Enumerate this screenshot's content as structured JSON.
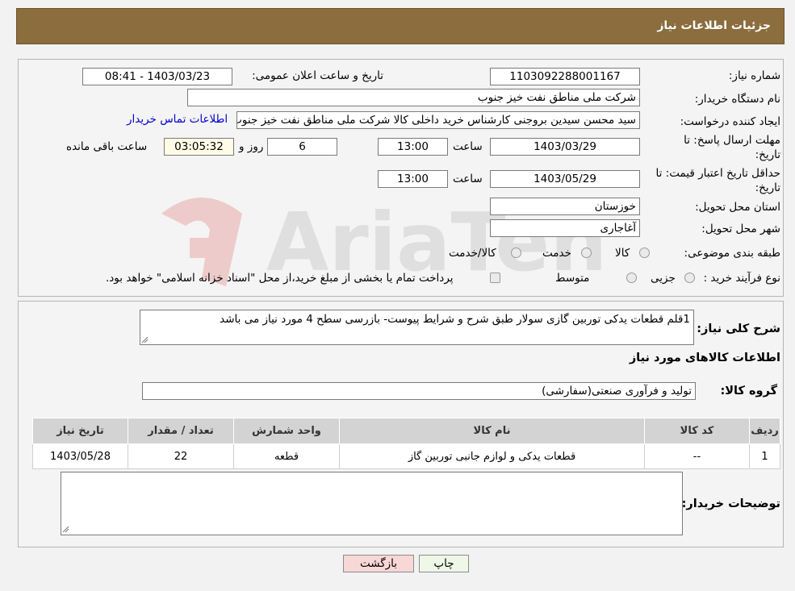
{
  "header": {
    "title": "جزئیات اطلاعات نیاز"
  },
  "fields": {
    "need_number_label": "شماره نیاز:",
    "need_number": "1103092288001167",
    "announce_label": "تاریخ و ساعت اعلان عمومی:",
    "announce_value": "1403/03/23 - 08:41",
    "buyer_org_label": "نام دستگاه خریدار:",
    "buyer_org": "شرکت ملی مناطق نفت خیز جنوب",
    "creator_label": "ایجاد کننده درخواست:",
    "creator": "سید محسن  سیدین بروجنی  کارشناس خرید داخلی کالا  شرکت ملی مناطق نفت خیز جنوب",
    "contact_link": "اطلاعات تماس خریدار",
    "deadline_label_1": "مهلت ارسال پاسخ: تا",
    "deadline_label_2": "تاریخ:",
    "deadline_date": "1403/03/29",
    "time_label": "ساعت",
    "deadline_time": "13:00",
    "days_value": "6",
    "days_label": "روز و",
    "remaining_time": "03:05:32",
    "remaining_label": "ساعت باقی مانده",
    "validity_label_1": "حداقل تاریخ اعتبار قیمت: تا",
    "validity_label_2": "تاریخ:",
    "validity_date": "1403/05/29",
    "validity_time": "13:00",
    "province_label": "استان محل تحویل:",
    "province": "خوزستان",
    "city_label": "شهر محل تحویل:",
    "city": "آغاجاری",
    "category_label": "طبقه بندی موضوعی:",
    "category_options": [
      "کالا",
      "خدمت",
      "کالا/خدمت"
    ],
    "process_label": "نوع فرآیند خرید :",
    "process_options": [
      "جزیی",
      "متوسط"
    ],
    "process_note": "پرداخت تمام یا بخشی از مبلغ خرید،از محل \"اسناد خزانه اسلامی\" خواهد بود."
  },
  "description": {
    "label": "شرح کلی نیاز:",
    "text": "1قلم قطعات یدکی توربین  گازی سولار طبق شرح و شرایط پیوست- بازرسی سطح 4 مورد نیاز می باشد"
  },
  "goods": {
    "section_title": "اطلاعات کالاهای مورد نیاز",
    "group_label": "گروه کالا:",
    "group_value": "تولید و فرآوری صنعتی(سفارشی)",
    "columns": [
      "ردیف",
      "کد کالا",
      "نام کالا",
      "واحد شمارش",
      "تعداد / مقدار",
      "تاریخ نیاز"
    ],
    "rows": [
      [
        "1",
        "--",
        "قطعات یدکی و لوازم جانبی توربین گاز",
        "قطعه",
        "22",
        "1403/05/28"
      ]
    ]
  },
  "buyer_notes": {
    "label": "توضیحات خریدار:",
    "text": ""
  },
  "buttons": {
    "print": "چاپ",
    "back": "بازگشت"
  },
  "colors": {
    "header": "#8b6d3e",
    "link": "#0000cc",
    "back_button": "#f8d7d7",
    "print_button": "#eef7e8"
  }
}
